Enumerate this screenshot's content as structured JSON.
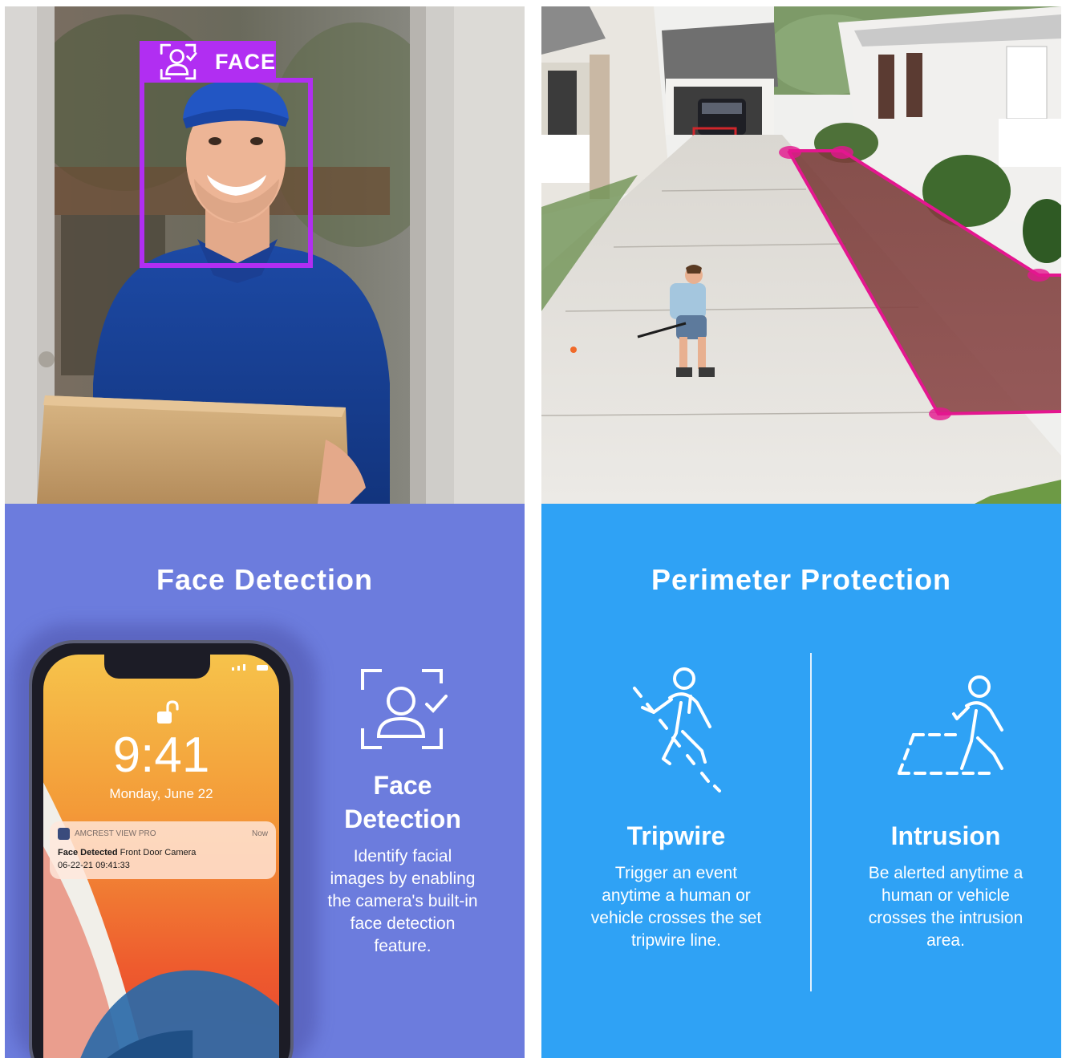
{
  "face_photo": {
    "tag_label": "FACE",
    "tag_icon": "face-scan-icon",
    "accent_color": "#b12ef2"
  },
  "perimeter_photo": {
    "zone_color": "#e4168f"
  },
  "face_section": {
    "title": "Face Detection",
    "background": "#6c7cdd",
    "phone": {
      "time": "9:41",
      "date": "Monday, June 22",
      "lock_icon": "unlock-icon",
      "notification": {
        "app_name": "AMCREST VIEW PRO",
        "timestamp": "Now",
        "title": "Face Detected",
        "message": "Front Door Camera",
        "datetime": "06-22-21  09:41:33"
      }
    },
    "feature": {
      "icon": "face-recognition-icon",
      "title_line1": "Face",
      "title_line2": "Detection",
      "description": [
        "Identify facial",
        "images by enabling",
        "the camera's built-in",
        "face detection",
        "feature."
      ]
    }
  },
  "perimeter_section": {
    "title": "Perimeter Protection",
    "background": "#2fa2f5",
    "tripwire": {
      "icon": "tripwire-person-icon",
      "title": "Tripwire",
      "description": [
        "Trigger an event",
        "anytime a human or",
        "vehicle crosses the set",
        "tripwire line."
      ]
    },
    "intrusion": {
      "icon": "intrusion-person-icon",
      "title": "Intrusion",
      "description": [
        "Be alerted anytime a",
        "human or vehicle",
        "crosses the intrusion",
        "area."
      ]
    }
  }
}
